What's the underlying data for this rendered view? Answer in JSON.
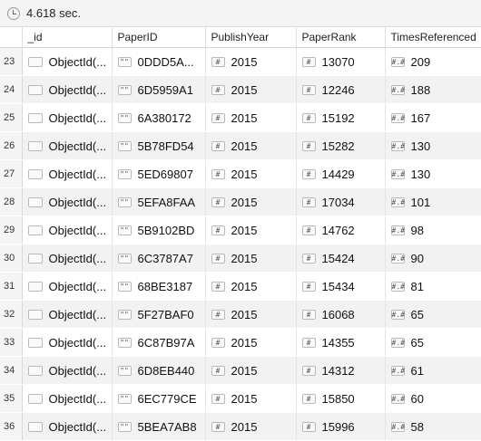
{
  "status": {
    "elapsed": "4.618 sec."
  },
  "columns": [
    "",
    "_id",
    "PaperID",
    "PublishYear",
    "PaperRank",
    "TimesReferenced"
  ],
  "icons": {
    "object": "object-id-icon",
    "string": "string-type-icon",
    "number": "number-type-icon"
  },
  "icon_glyphs": {
    "string": "\"\"",
    "int": "#",
    "double": "#.#"
  },
  "rows": [
    {
      "n": "23",
      "id": "ObjectId(...",
      "paper_id": "0DDD5A...",
      "year": "2015",
      "rank": "13070",
      "refs": "209"
    },
    {
      "n": "24",
      "id": "ObjectId(...",
      "paper_id": "6D5959A1",
      "year": "2015",
      "rank": "12246",
      "refs": "188"
    },
    {
      "n": "25",
      "id": "ObjectId(...",
      "paper_id": "6A380172",
      "year": "2015",
      "rank": "15192",
      "refs": "167"
    },
    {
      "n": "26",
      "id": "ObjectId(...",
      "paper_id": "5B78FD54",
      "year": "2015",
      "rank": "15282",
      "refs": "130"
    },
    {
      "n": "27",
      "id": "ObjectId(...",
      "paper_id": "5ED69807",
      "year": "2015",
      "rank": "14429",
      "refs": "130"
    },
    {
      "n": "28",
      "id": "ObjectId(...",
      "paper_id": "5EFA8FAA",
      "year": "2015",
      "rank": "17034",
      "refs": "101"
    },
    {
      "n": "29",
      "id": "ObjectId(...",
      "paper_id": "5B9102BD",
      "year": "2015",
      "rank": "14762",
      "refs": "98"
    },
    {
      "n": "30",
      "id": "ObjectId(...",
      "paper_id": "6C3787A7",
      "year": "2015",
      "rank": "15424",
      "refs": "90"
    },
    {
      "n": "31",
      "id": "ObjectId(...",
      "paper_id": "68BE3187",
      "year": "2015",
      "rank": "15434",
      "refs": "81"
    },
    {
      "n": "32",
      "id": "ObjectId(...",
      "paper_id": "5F27BAF0",
      "year": "2015",
      "rank": "16068",
      "refs": "65"
    },
    {
      "n": "33",
      "id": "ObjectId(...",
      "paper_id": "6C87B97A",
      "year": "2015",
      "rank": "14355",
      "refs": "65"
    },
    {
      "n": "34",
      "id": "ObjectId(...",
      "paper_id": "6D8EB440",
      "year": "2015",
      "rank": "14312",
      "refs": "61"
    },
    {
      "n": "35",
      "id": "ObjectId(...",
      "paper_id": "6EC779CE",
      "year": "2015",
      "rank": "15850",
      "refs": "60"
    },
    {
      "n": "36",
      "id": "ObjectId(...",
      "paper_id": "5BEA7AB8",
      "year": "2015",
      "rank": "15996",
      "refs": "58"
    }
  ]
}
